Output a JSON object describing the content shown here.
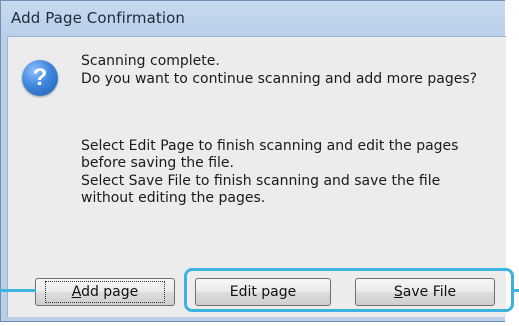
{
  "window": {
    "title": "Add Page Confirmation"
  },
  "message": {
    "icon": "question-icon",
    "line1": "Scanning complete.",
    "line2": "Do you want to continue scanning and add more pages?",
    "info1": "Select Edit Page to finish scanning and edit the pages",
    "info2": "before saving the file.",
    "info3": "Select Save File to finish scanning and save the file",
    "info4": "without editing the pages."
  },
  "buttons": {
    "add_page": {
      "underline": "A",
      "rest": "dd page"
    },
    "edit_page": {
      "label": "Edit page"
    },
    "save_file": {
      "underline": "S",
      "rest": "ave File"
    }
  },
  "colors": {
    "callout": "#3cb2e0",
    "title_bar": "#c7d9ee"
  }
}
